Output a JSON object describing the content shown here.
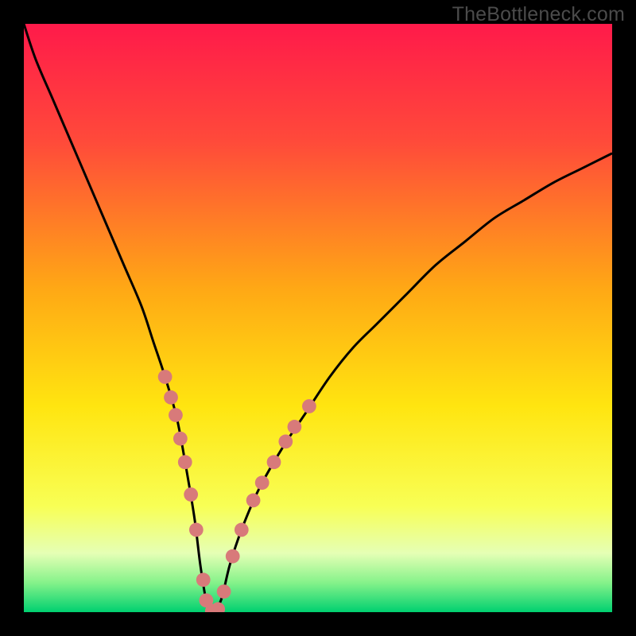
{
  "watermark": "TheBottleneck.com",
  "chart_data": {
    "type": "line",
    "title": "",
    "xlabel": "",
    "ylabel": "",
    "xlim": [
      0,
      100
    ],
    "ylim": [
      0,
      100
    ],
    "gradient_stops": [
      {
        "pos": 0.0,
        "color": "#ff1a4a"
      },
      {
        "pos": 0.2,
        "color": "#ff4a3a"
      },
      {
        "pos": 0.45,
        "color": "#ffa815"
      },
      {
        "pos": 0.65,
        "color": "#ffe510"
      },
      {
        "pos": 0.82,
        "color": "#f8ff55"
      },
      {
        "pos": 0.9,
        "color": "#e5ffb5"
      },
      {
        "pos": 0.95,
        "color": "#85f28a"
      },
      {
        "pos": 1.0,
        "color": "#00d070"
      }
    ],
    "series": [
      {
        "name": "bottleneck-curve",
        "x": [
          0,
          2,
          5,
          8,
          11,
          14,
          17,
          20,
          22,
          24,
          26,
          27.5,
          29,
          30,
          31,
          32,
          33.5,
          35,
          37,
          40,
          44,
          48,
          52,
          56,
          60,
          65,
          70,
          75,
          80,
          85,
          90,
          95,
          100
        ],
        "y": [
          100,
          94,
          87,
          80,
          73,
          66,
          59,
          52,
          46,
          40,
          33,
          25,
          16,
          8,
          2,
          0,
          2,
          8,
          14,
          21,
          28,
          34,
          40,
          45,
          49,
          54,
          59,
          63,
          67,
          70,
          73,
          75.5,
          78
        ]
      }
    ],
    "markers": {
      "name": "highlight-dots",
      "color": "#d87a7a",
      "radius_pct": 1.2,
      "points": [
        {
          "x": 24.0,
          "y": 40.0
        },
        {
          "x": 25.0,
          "y": 36.5
        },
        {
          "x": 25.8,
          "y": 33.5
        },
        {
          "x": 26.6,
          "y": 29.5
        },
        {
          "x": 27.4,
          "y": 25.5
        },
        {
          "x": 28.4,
          "y": 20.0
        },
        {
          "x": 29.3,
          "y": 14.0
        },
        {
          "x": 30.5,
          "y": 5.5
        },
        {
          "x": 31.0,
          "y": 2.0
        },
        {
          "x": 32.0,
          "y": 0.2
        },
        {
          "x": 33.0,
          "y": 0.5
        },
        {
          "x": 34.0,
          "y": 3.5
        },
        {
          "x": 35.5,
          "y": 9.5
        },
        {
          "x": 37.0,
          "y": 14.0
        },
        {
          "x": 39.0,
          "y": 19.0
        },
        {
          "x": 40.5,
          "y": 22.0
        },
        {
          "x": 42.5,
          "y": 25.5
        },
        {
          "x": 44.5,
          "y": 29.0
        },
        {
          "x": 46.0,
          "y": 31.5
        },
        {
          "x": 48.5,
          "y": 35.0
        }
      ]
    }
  }
}
